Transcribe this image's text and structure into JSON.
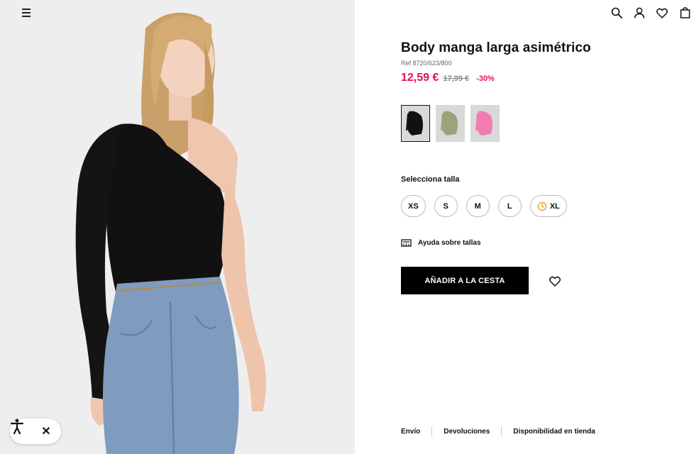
{
  "nav": {
    "menu_icon": "hamburger-menu-icon",
    "header_icons": [
      "search-icon",
      "user-icon",
      "heart-icon",
      "bag-icon"
    ]
  },
  "product": {
    "title": "Body manga larga asimétrico",
    "ref": "Ref 8720/623/800",
    "price_now": "12,59 €",
    "price_old": "17,99 €",
    "discount": "-30%",
    "accent_color": "#e0115f",
    "colors": [
      {
        "name": "negro",
        "hex": "#111111",
        "selected": true
      },
      {
        "name": "verde",
        "hex": "#9aa37a",
        "selected": false
      },
      {
        "name": "rosa",
        "hex": "#f07cb0",
        "selected": false
      }
    ]
  },
  "sizes": {
    "label": "Selecciona talla",
    "options": [
      "XS",
      "S",
      "M",
      "L",
      "XL"
    ],
    "xl_icon": "clock-icon"
  },
  "help": {
    "label": "Ayuda sobre tallas",
    "icon": "ruler-icon"
  },
  "cart": {
    "add_label": "AÑADIR A LA CESTA",
    "wishlist_icon": "heart-icon"
  },
  "footer": {
    "links": [
      "Envío",
      "Devoluciones",
      "Disponibilidad en tienda"
    ]
  },
  "accessibility": {
    "icon": "accessibility-icon",
    "close": "✕"
  }
}
